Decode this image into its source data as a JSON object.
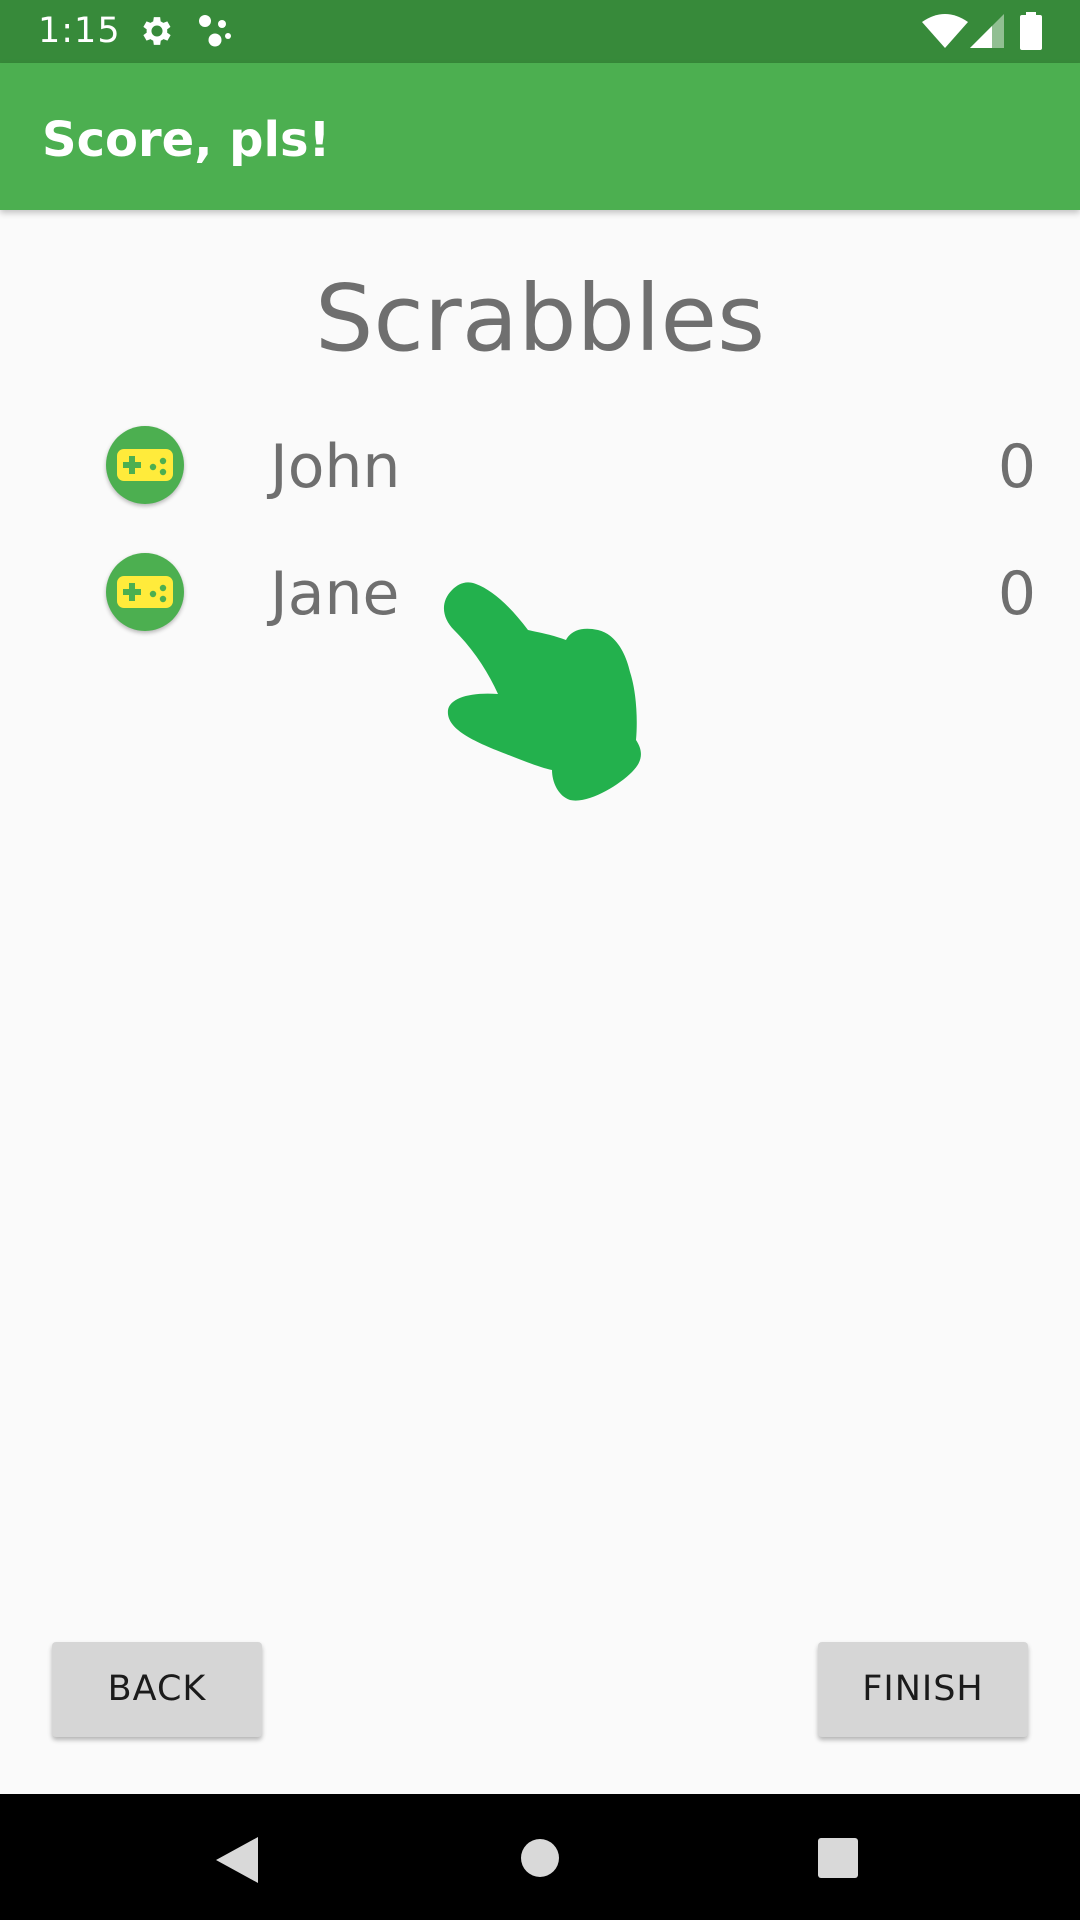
{
  "status_bar": {
    "time": "1:15",
    "icons": [
      "gear-icon",
      "assistant-dots-icon",
      "wifi-icon",
      "signal-icon",
      "battery-icon"
    ]
  },
  "app_bar": {
    "title": "Score, pls!"
  },
  "game": {
    "title": "Scrabbles"
  },
  "players": [
    {
      "name": "John",
      "score": "0",
      "icon": "gamepad-icon"
    },
    {
      "name": "Jane",
      "score": "0",
      "icon": "gamepad-icon"
    }
  ],
  "buttons": {
    "back_label": "BACK",
    "finish_label": "FINISH"
  },
  "nav_bar": {
    "icons": [
      "back-triangle-icon",
      "home-circle-icon",
      "recents-square-icon"
    ]
  },
  "colors": {
    "status_bar": "#378a3a",
    "app_bar": "#4caf50",
    "background": "#fafafa",
    "text_secondary": "#6f6f6f",
    "avatar": "#4caf50",
    "gamepad": "#ffeb3b",
    "button": "#d6d6d6",
    "cursor": "#23b14d"
  }
}
